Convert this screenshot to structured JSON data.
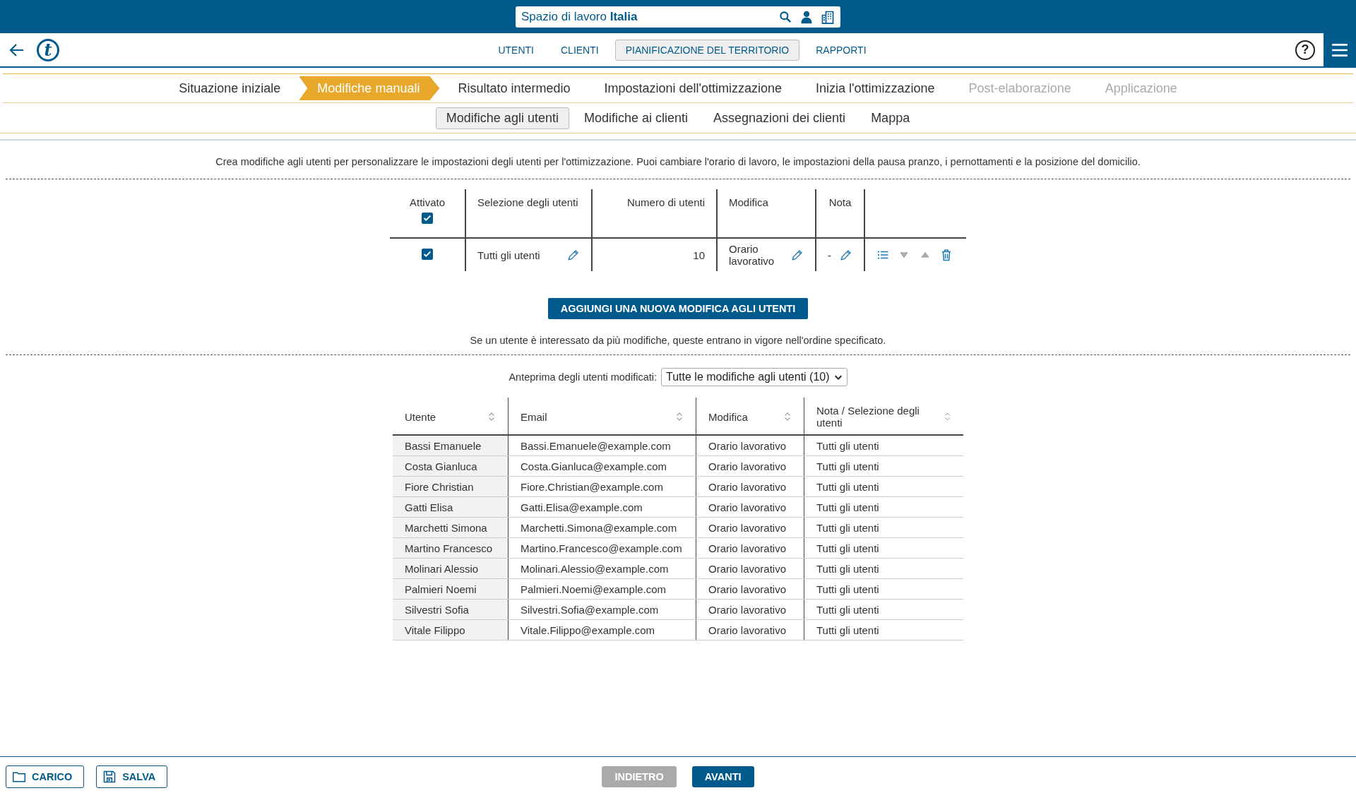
{
  "header": {
    "workspace": "Spazio di lavoro **Italia**",
    "logo": "t",
    "help": "?"
  },
  "nav_tabs": [
    {
      "label": "UTENTI",
      "selected": false
    },
    {
      "label": "CLIENTI",
      "selected": false
    },
    {
      "label": "PIANIFICAZIONE DEL TERRITORIO",
      "selected": true
    },
    {
      "label": "RAPPORTI",
      "selected": false
    }
  ],
  "steps": [
    {
      "label": "Situazione iniziale",
      "selected": false,
      "disabled": false
    },
    {
      "label": "Modifiche manuali",
      "selected": true,
      "disabled": false
    },
    {
      "label": "Risultato intermedio",
      "selected": false,
      "disabled": false
    },
    {
      "label": "Impostazioni dell'ottimizzazione",
      "selected": false,
      "disabled": false
    },
    {
      "label": "Inizia l'ottimizzazione",
      "selected": false,
      "disabled": false
    },
    {
      "label": "Post-elaborazione",
      "selected": false,
      "disabled": true
    },
    {
      "label": "Applicazione",
      "selected": false,
      "disabled": true
    }
  ],
  "sub_tabs": [
    {
      "label": "Modifiche agli utenti",
      "selected": true
    },
    {
      "label": "Modifiche ai clienti",
      "selected": false
    },
    {
      "label": "Assegnazioni dei clienti",
      "selected": false
    },
    {
      "label": "Mappa",
      "selected": false
    }
  ],
  "description": "Crea modifiche agli utenti per personalizzare le impostazioni degli utenti per l'ottimizzazione. Puoi cambiare l'orario di lavoro, le impostazioni della pausa pranzo, i pernottamenti e la posizione del domicilio.",
  "rules_table": {
    "columns": [
      "Attivato",
      "Selezione degli utenti",
      "Numero di utenti",
      "Modifica",
      "Nota"
    ],
    "all_checked": true,
    "rows": [
      {
        "checked": true,
        "selection": "Tutti gli utenti",
        "count": "10",
        "modification": "Orario lavorativo",
        "note": "-"
      }
    ]
  },
  "add_button": "AGGIUNGI UNA NUOVA MODIFICA AGLI UTENTI",
  "order_note": "Se un utente è interessato da più modifiche, queste entrano in vigore nell'ordine specificato.",
  "preview": {
    "label": "Anteprima degli utenti modificati:",
    "select_value": "Tutte le modifiche agli utenti (10)",
    "columns": [
      "Utente",
      "Email",
      "Modifica",
      "Nota / Selezione degli utenti"
    ],
    "rows": [
      [
        "Bassi Emanuele",
        "Bassi.Emanuele@example.com",
        "Orario lavorativo",
        "Tutti gli utenti"
      ],
      [
        "Costa Gianluca",
        "Costa.Gianluca@example.com",
        "Orario lavorativo",
        "Tutti gli utenti"
      ],
      [
        "Fiore Christian",
        "Fiore.Christian@example.com",
        "Orario lavorativo",
        "Tutti gli utenti"
      ],
      [
        "Gatti Elisa",
        "Gatti.Elisa@example.com",
        "Orario lavorativo",
        "Tutti gli utenti"
      ],
      [
        "Marchetti Simona",
        "Marchetti.Simona@example.com",
        "Orario lavorativo",
        "Tutti gli utenti"
      ],
      [
        "Martino Francesco",
        "Martino.Francesco@example.com",
        "Orario lavorativo",
        "Tutti gli utenti"
      ],
      [
        "Molinari Alessio",
        "Molinari.Alessio@example.com",
        "Orario lavorativo",
        "Tutti gli utenti"
      ],
      [
        "Palmieri Noemi",
        "Palmieri.Noemi@example.com",
        "Orario lavorativo",
        "Tutti gli utenti"
      ],
      [
        "Silvestri Sofia",
        "Silvestri.Sofia@example.com",
        "Orario lavorativo",
        "Tutti gli utenti"
      ],
      [
        "Vitale Filippo",
        "Vitale.Filippo@example.com",
        "Orario lavorativo",
        "Tutti gli utenti"
      ]
    ]
  },
  "footer": {
    "left_buttons": [
      {
        "label": "CARICO",
        "kind": "load"
      },
      {
        "label": "SALVA",
        "kind": "save"
      }
    ],
    "back_button": {
      "label": "INDIETRO",
      "disabled": true
    },
    "next_button": "AVANTI"
  }
}
